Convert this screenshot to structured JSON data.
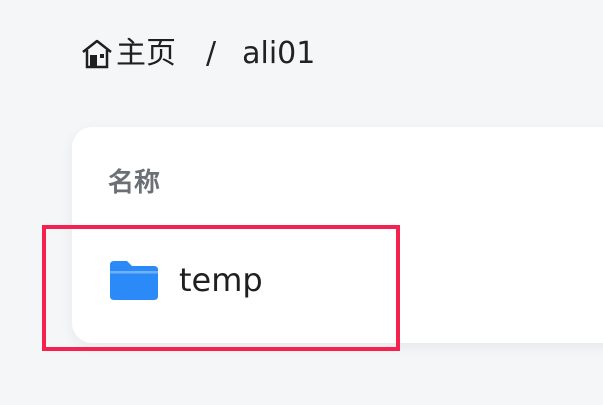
{
  "breadcrumb": {
    "home_icon": "home-icon",
    "home_label": "主页",
    "separator": "/",
    "current": "ali01"
  },
  "table": {
    "column_header": "名称",
    "rows": [
      {
        "icon": "folder-icon",
        "name": "temp",
        "type": "folder"
      }
    ]
  },
  "colors": {
    "background": "#f5f6f8",
    "card": "#ffffff",
    "folder": "#2b8af7",
    "highlight": "#f5224f",
    "header_text": "#6b6f76"
  }
}
